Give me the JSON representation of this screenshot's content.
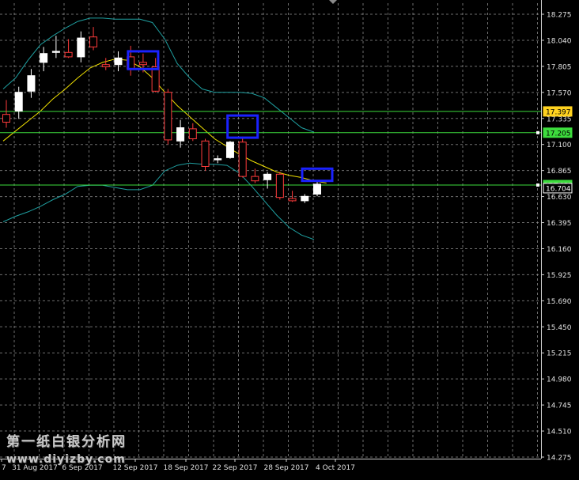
{
  "chart_data": {
    "type": "candlestick",
    "y_ticks": [
      "18.275",
      "18.040",
      "17.805",
      "17.570",
      "17.335",
      "17.100",
      "16.865",
      "16.630",
      "16.395",
      "16.160",
      "15.925",
      "15.690",
      "15.450",
      "15.215",
      "14.980",
      "14.745",
      "14.510",
      "14.275"
    ],
    "ylim": [
      14.275,
      18.275
    ],
    "x_tick_labels": [
      "7",
      "31 Aug 2017",
      "6 Sep 2017",
      "12 Sep 2017",
      "18 Sep 2017",
      "22 Sep 2017",
      "28 Sep 2017",
      "4 Oct 2017"
    ],
    "grid": true,
    "price_tags": [
      {
        "value": "17.397",
        "color": "#ffd21f"
      },
      {
        "value": "17.205",
        "color": "#3ddc3d"
      },
      {
        "value": "16.732",
        "color": "#3ddc3d"
      },
      {
        "value": "16.704",
        "color": "#ffffff"
      }
    ],
    "horizontal_lines": [
      17.397,
      17.205,
      16.732
    ],
    "candles": [
      {
        "o": 17.37,
        "h": 17.5,
        "l": 17.25,
        "c": 17.3
      },
      {
        "o": 17.4,
        "h": 17.62,
        "l": 17.33,
        "c": 17.57
      },
      {
        "o": 17.58,
        "h": 17.78,
        "l": 17.52,
        "c": 17.72
      },
      {
        "o": 17.84,
        "h": 17.98,
        "l": 17.76,
        "c": 17.92
      },
      {
        "o": 17.93,
        "h": 18.08,
        "l": 17.88,
        "c": 17.94
      },
      {
        "o": 17.93,
        "h": 18.05,
        "l": 17.88,
        "c": 17.89
      },
      {
        "o": 17.89,
        "h": 18.12,
        "l": 17.84,
        "c": 18.06
      },
      {
        "o": 18.07,
        "h": 18.16,
        "l": 17.95,
        "c": 17.98
      },
      {
        "o": 17.82,
        "h": 17.88,
        "l": 17.77,
        "c": 17.8
      },
      {
        "o": 17.82,
        "h": 17.94,
        "l": 17.76,
        "c": 17.88
      },
      {
        "o": 17.89,
        "h": 17.99,
        "l": 17.72,
        "c": 17.78
      },
      {
        "o": 17.84,
        "h": 17.92,
        "l": 17.75,
        "c": 17.82
      },
      {
        "o": 17.8,
        "h": 17.88,
        "l": 17.57,
        "c": 17.58
      },
      {
        "o": 17.57,
        "h": 17.6,
        "l": 17.1,
        "c": 17.14
      },
      {
        "o": 17.13,
        "h": 17.32,
        "l": 17.07,
        "c": 17.25
      },
      {
        "o": 17.24,
        "h": 17.29,
        "l": 17.13,
        "c": 17.15
      },
      {
        "o": 17.13,
        "h": 17.15,
        "l": 16.86,
        "c": 16.9
      },
      {
        "o": 16.96,
        "h": 17.0,
        "l": 16.93,
        "c": 16.97
      },
      {
        "o": 16.98,
        "h": 17.13,
        "l": 16.97,
        "c": 17.12
      },
      {
        "o": 17.12,
        "h": 17.17,
        "l": 16.8,
        "c": 16.81
      },
      {
        "o": 16.81,
        "h": 16.88,
        "l": 16.75,
        "c": 16.77
      },
      {
        "o": 16.78,
        "h": 16.85,
        "l": 16.7,
        "c": 16.83
      },
      {
        "o": 16.83,
        "h": 16.85,
        "l": 16.6,
        "c": 16.62
      },
      {
        "o": 16.61,
        "h": 16.68,
        "l": 16.58,
        "c": 16.59
      },
      {
        "o": 16.59,
        "h": 16.65,
        "l": 16.57,
        "c": 16.63
      },
      {
        "o": 16.65,
        "h": 16.76,
        "l": 16.63,
        "c": 16.74
      }
    ],
    "ma_middle": [
      17.13,
      17.22,
      17.31,
      17.4,
      17.51,
      17.6,
      17.7,
      17.79,
      17.84,
      17.87,
      17.86,
      17.8,
      17.7,
      17.57,
      17.45,
      17.35,
      17.25,
      17.15,
      17.08,
      17.01,
      16.95,
      16.9,
      16.85,
      16.82,
      16.8,
      16.77,
      16.75
    ],
    "bb_upper": [
      17.6,
      17.7,
      17.86,
      18.0,
      18.08,
      18.15,
      18.21,
      18.24,
      18.24,
      18.23,
      18.23,
      18.23,
      18.2,
      18.05,
      17.83,
      17.7,
      17.6,
      17.57,
      17.57,
      17.57,
      17.56,
      17.52,
      17.43,
      17.34,
      17.25,
      17.21
    ],
    "bb_lower": [
      16.4,
      16.45,
      16.49,
      16.54,
      16.6,
      16.65,
      16.72,
      16.73,
      16.73,
      16.71,
      16.69,
      16.69,
      16.73,
      16.86,
      16.91,
      16.93,
      16.92,
      16.92,
      16.91,
      16.84,
      16.72,
      16.59,
      16.46,
      16.35,
      16.28,
      16.24
    ],
    "annotation_boxes": [
      {
        "candle": 11,
        "y_top": 17.94,
        "y_bottom": 17.78,
        "color": "#1a22ff"
      },
      {
        "candle": 19,
        "y_top": 17.36,
        "y_bottom": 17.16,
        "color": "#1a22ff"
      },
      {
        "candle": 25,
        "y_top": 16.88,
        "y_bottom": 16.77,
        "color": "#1a22ff"
      }
    ],
    "colors": {
      "background": "#000000",
      "grid": "#8a8a8a",
      "bull": "#ffffff",
      "bear": "#ff3b3b",
      "ma": "#f0e000",
      "band": "#1f9fa0",
      "hline": "#3ddc3d"
    }
  },
  "watermark": {
    "line1": "第一纸白银分析网",
    "line2": "www.diyizby.com"
  }
}
